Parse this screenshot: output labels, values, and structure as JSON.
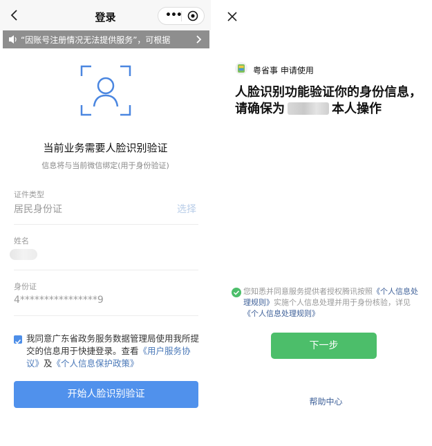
{
  "login": {
    "title": "登录",
    "notice": "“因账号注册情况无法提供服务”，可根据",
    "main_title": "当前业务需要人脸识别验证",
    "sub_title": "信息将与当前微信绑定(用于身份验证)",
    "fields": {
      "id_type": {
        "label": "证件类型",
        "value": "居民身份证",
        "action": "选择"
      },
      "name": {
        "label": "姓名"
      },
      "id_number": {
        "label": "身份证",
        "value": "4****************9"
      }
    },
    "agreement": {
      "text_before": "我同意广东省政务服务数据管理局使用我所提交的信息用于快捷登录。查看",
      "link_user": "《用户服务协议》",
      "and": "及",
      "link_privacy": "《个人信息保护政策》",
      "checked": true
    },
    "start_button": "开始人脸识别验证"
  },
  "face_auth": {
    "app_name": "粤省事 申请使用",
    "title_part1": "人脸识别功能验证你的身份信息，请确保为",
    "title_part2": "本人操作",
    "consent_before": "您知悉并同意服务提供者授权腾讯按照",
    "consent_link1": "《个人信息处理规则》",
    "consent_middle": "实施个人信息处理并用于身份核验，详见",
    "consent_link2": "《个人信息处理规则》",
    "next_button": "下一步",
    "help": "帮助中心"
  },
  "colors": {
    "primary_blue": "#5091ec",
    "primary_green": "#4cbe6a",
    "link_blue": "#3f6199"
  },
  "icons": [
    "back-icon",
    "more-icon",
    "target-icon",
    "speaker-icon",
    "chevron-right-icon",
    "face-scan-icon",
    "checkbox-icon",
    "close-icon",
    "app-logo",
    "check-circle-icon"
  ]
}
